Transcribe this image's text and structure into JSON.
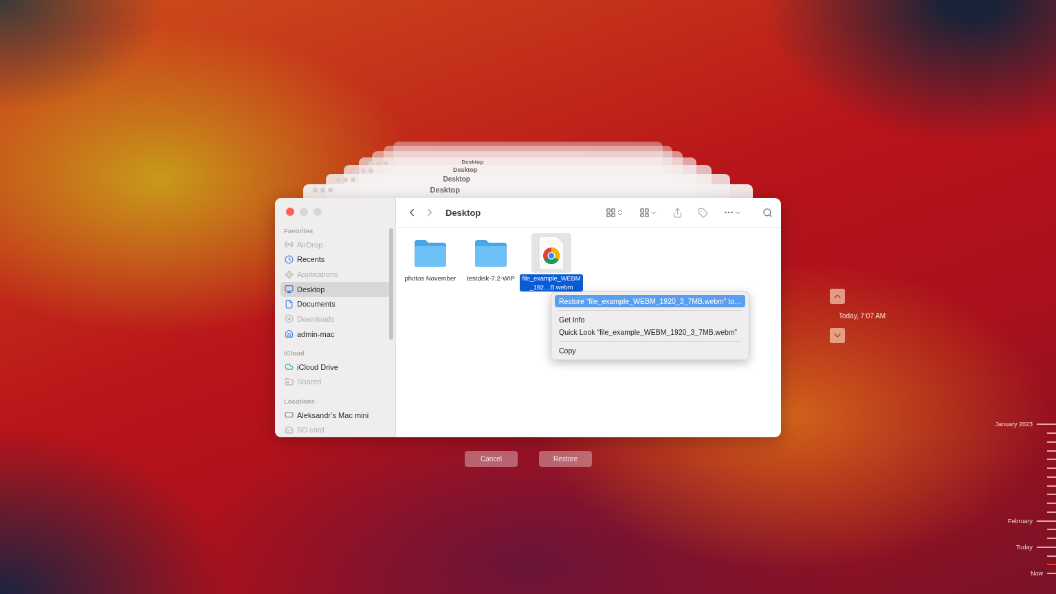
{
  "back_windows": [
    {
      "title": "Desktop"
    },
    {
      "title": "Desktop"
    },
    {
      "title": "Desktop"
    },
    {
      "title": "Desktop"
    }
  ],
  "window": {
    "title": "Desktop",
    "sidebar": [
      {
        "heading": "Favorites",
        "items": [
          {
            "label": "AirDrop",
            "kind": "airdrop",
            "disabled": true,
            "selected": false
          },
          {
            "label": "Recents",
            "kind": "clock",
            "disabled": false,
            "selected": false
          },
          {
            "label": "Applications",
            "kind": "apps",
            "disabled": true,
            "selected": false
          },
          {
            "label": "Desktop",
            "kind": "desktop",
            "disabled": false,
            "selected": true
          },
          {
            "label": "Documents",
            "kind": "document",
            "disabled": false,
            "selected": false
          },
          {
            "label": "Downloads",
            "kind": "download",
            "disabled": true,
            "selected": false
          },
          {
            "label": "admin-mac",
            "kind": "home",
            "disabled": false,
            "selected": false
          }
        ]
      },
      {
        "heading": "iCloud",
        "items": [
          {
            "label": "iCloud Drive",
            "kind": "cloud",
            "disabled": false,
            "selected": false
          },
          {
            "label": "Shared",
            "kind": "shared",
            "disabled": true,
            "selected": false
          }
        ]
      },
      {
        "heading": "Locations",
        "items": [
          {
            "label": "Aleksandr’s Mac mini",
            "kind": "computer",
            "disabled": false,
            "selected": false
          },
          {
            "label": "SD card",
            "kind": "drive",
            "disabled": true,
            "selected": false
          }
        ]
      }
    ],
    "files": [
      {
        "name": "photos November",
        "kind": "folder",
        "selected": false
      },
      {
        "name": "testdisk-7.2-WIP",
        "kind": "folder",
        "selected": false
      },
      {
        "name": "file_example_WEBM_192…B.webm",
        "kind": "document",
        "selected": true
      }
    ]
  },
  "context_menu": [
    [
      {
        "label": "Restore “file_example_WEBM_1920_3_7MB.webm” to…",
        "selected": true
      }
    ],
    [
      {
        "label": "Get Info",
        "selected": false
      },
      {
        "label": "Quick Look “file_example_WEBM_1920_3_7MB.webm”",
        "selected": false
      }
    ],
    [
      {
        "label": "Copy",
        "selected": false
      }
    ]
  ],
  "buttons": [
    "Cancel",
    "Restore"
  ],
  "time_navigator": {
    "date": "Today, 7:07 AM"
  },
  "timeline": [
    {
      "label": "January 2023"
    },
    {
      "label": "February"
    },
    {
      "label": "Today"
    },
    {
      "label": "Now"
    }
  ]
}
